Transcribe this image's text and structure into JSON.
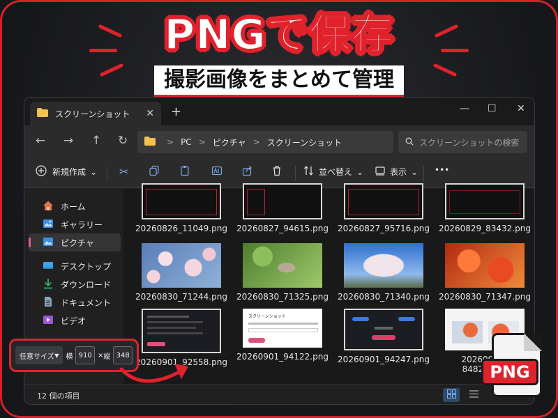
{
  "headline": {
    "title": "PNGで保存",
    "subtitle": "撮影画像をまとめて管理"
  },
  "window": {
    "tab_title": "スクリーンショット",
    "tab_close": "✕",
    "new_tab": "+",
    "controls": {
      "minimize": "—",
      "maximize": "☐",
      "close": "✕"
    },
    "nav": {
      "back": "←",
      "forward": "→",
      "up": "↑",
      "refresh": "↻"
    },
    "breadcrumb": [
      "PC",
      "ピクチャ",
      "スクリーンショット"
    ],
    "breadcrumb_sep": ">",
    "search_placeholder": "スクリーンショットの検索",
    "toolbar": {
      "new_label": "新規作成",
      "sort_label": "並べ替え",
      "view_label": "表示",
      "more": "•••",
      "chevron": "⌄"
    },
    "sidebar": [
      {
        "label": "ホーム",
        "icon": "home-icon",
        "color": "#e0764a"
      },
      {
        "label": "ギャラリー",
        "icon": "gallery-icon",
        "color": "#3a8fe0"
      },
      {
        "label": "ピクチャ",
        "icon": "pictures-icon",
        "color": "#3a8fe0",
        "selected": true
      },
      {
        "label": "デスクトップ",
        "icon": "desktop-icon",
        "color": "#3fa3e8"
      },
      {
        "label": "ダウンロード",
        "icon": "download-icon",
        "color": "#39b06b"
      },
      {
        "label": "ドキュメント",
        "icon": "documents-icon",
        "color": "#8ea3b8"
      },
      {
        "label": "ビデオ",
        "icon": "videos-icon",
        "color": "#9b59d6"
      }
    ],
    "files": [
      {
        "name": "20260826_11049.png",
        "kind": "dark"
      },
      {
        "name": "20260827_94615.png",
        "kind": "dark"
      },
      {
        "name": "20260827_95716.png",
        "kind": "dark"
      },
      {
        "name": "20260829_83432.png",
        "kind": "dark"
      },
      {
        "name": "20260830_71244.png",
        "kind": "photo-blossom"
      },
      {
        "name": "20260830_71325.png",
        "kind": "photo-bird"
      },
      {
        "name": "20260830_71340.png",
        "kind": "photo-tree"
      },
      {
        "name": "20260830_71347.png",
        "kind": "photo-maple"
      },
      {
        "name": "20260901_92558.png",
        "kind": "ui-dark"
      },
      {
        "name": "20260901_94122.png",
        "kind": "ui-light",
        "thumb_title": "スクリーンショット"
      },
      {
        "name": "20260901_94247.png",
        "kind": "ui-buttons"
      },
      {
        "name": "20260907_84821.png",
        "kind": "ui-gallery",
        "name_line1": "20260907_",
        "name_line2": "84821.png"
      }
    ],
    "status": "12 個の項目"
  },
  "size_widget": {
    "mode": "任意サイズ",
    "width_label": "横",
    "width": "910",
    "height_label": "縦",
    "height": "348",
    "times": "×"
  },
  "png_badge": "PNG",
  "colors": {
    "accent_red": "#e0222c",
    "selection_pink": "#e05ba0",
    "folder_yellow": "#f2c14e"
  }
}
